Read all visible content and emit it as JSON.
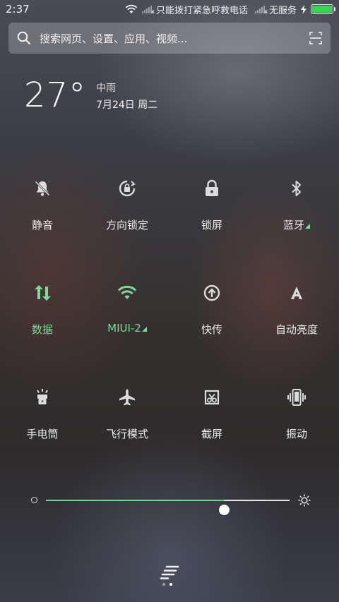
{
  "status_bar": {
    "time": "2:37",
    "carrier_1": "只能拨打紧急呼救电话",
    "carrier_2": "无服务",
    "battery_level": 1.0,
    "battery_color": "#39d353"
  },
  "search": {
    "placeholder": "搜索网页、设置、应用、视频..."
  },
  "weather": {
    "temperature": "27°",
    "condition": "中雨",
    "date": "7月24日 周二"
  },
  "toggles": [
    {
      "label": "静音",
      "icon": "mute-bell-icon",
      "active": false
    },
    {
      "label": "方向锁定",
      "icon": "rotation-lock-icon",
      "active": false
    },
    {
      "label": "锁屏",
      "icon": "lock-icon",
      "active": false
    },
    {
      "label": "蓝牙",
      "icon": "bluetooth-icon",
      "active": false,
      "has_submenu": true
    },
    {
      "label": "数据",
      "icon": "mobile-data-icon",
      "active": true
    },
    {
      "label": "MIUI-2",
      "icon": "wifi-icon",
      "active": true,
      "has_submenu": true
    },
    {
      "label": "快传",
      "icon": "quick-transfer-icon",
      "active": false
    },
    {
      "label": "自动亮度",
      "icon": "auto-brightness-icon",
      "active": false
    },
    {
      "label": "手电筒",
      "icon": "flashlight-icon",
      "active": false
    },
    {
      "label": "飞行模式",
      "icon": "airplane-icon",
      "active": false
    },
    {
      "label": "截屏",
      "icon": "screenshot-icon",
      "active": false
    },
    {
      "label": "振动",
      "icon": "vibrate-icon",
      "active": false
    }
  ],
  "brightness": {
    "level": 0.73,
    "accent_color": "#6fd592"
  },
  "pager": {
    "current_page": 2,
    "total_pages": 2
  }
}
